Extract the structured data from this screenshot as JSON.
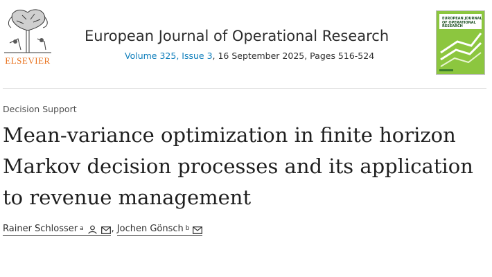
{
  "publisher": {
    "logo_text": "ELSEVIER"
  },
  "journal": {
    "name": "European Journal of Operational Research",
    "volume_issue_link": "Volume 325, Issue 3",
    "date_pages": ", 16 September 2025, Pages 516-524",
    "cover_title": "EUROPEAN JOURNAL OF OPERATIONAL RESEARCH"
  },
  "article": {
    "section": "Decision Support",
    "title": "Mean-variance optimization in finite horizon Markov decision processes and its application to revenue management"
  },
  "authors": [
    {
      "name": "Rainer Schlosser",
      "affiliation": "a",
      "icons": [
        "person-icon",
        "envelope-icon"
      ]
    },
    {
      "name": "Jochen Gönsch",
      "affiliation": "b",
      "icons": [
        "envelope-icon"
      ]
    }
  ],
  "author_separator": ",",
  "colors": {
    "elsevier_orange": "#e9711c",
    "link_blue": "#0c7dbb",
    "cover_green": "#8cc63f"
  }
}
